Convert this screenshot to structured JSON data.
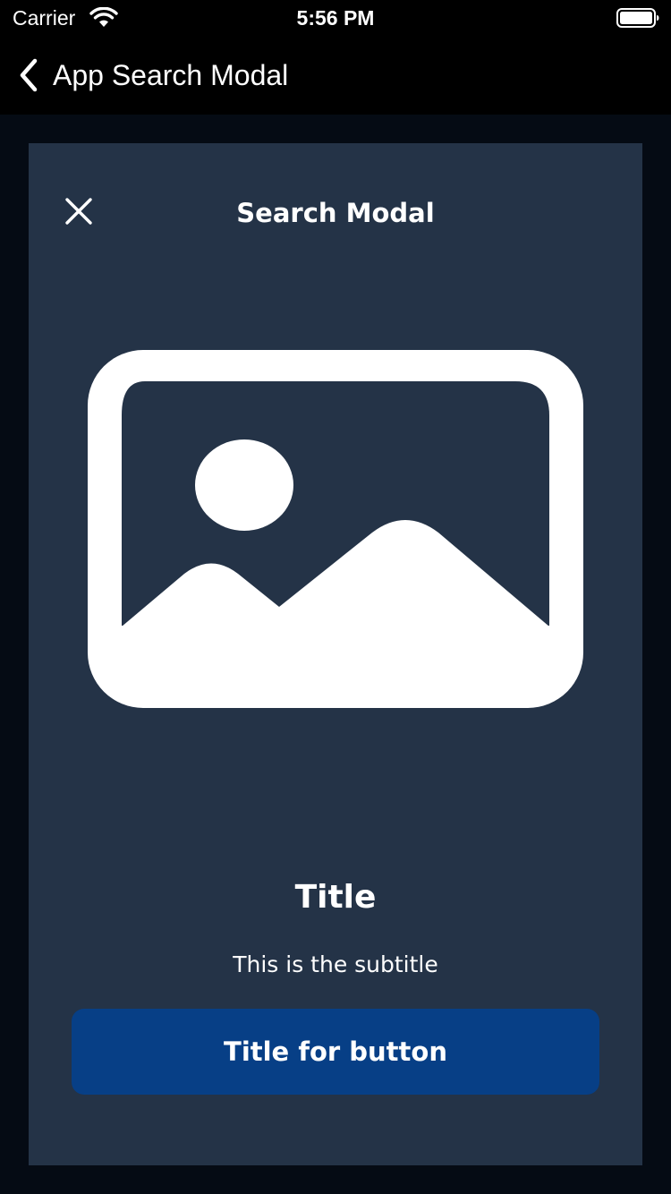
{
  "status_bar": {
    "carrier": "Carrier",
    "time": "5:56 PM",
    "wifi_icon": "wifi-icon",
    "battery_icon": "battery-full-icon"
  },
  "nav": {
    "back_icon": "chevron-left-icon",
    "title": "App Search Modal"
  },
  "modal": {
    "close_icon": "close-icon",
    "header": "Search Modal",
    "illustration_icon": "image-placeholder-icon",
    "title": "Title",
    "subtitle": "This is the subtitle",
    "button_label": "Title for button"
  },
  "colors": {
    "background": "#050b14",
    "bar_background": "#000000",
    "modal_background": "#243347",
    "button_background": "#073f86",
    "text": "#ffffff"
  }
}
